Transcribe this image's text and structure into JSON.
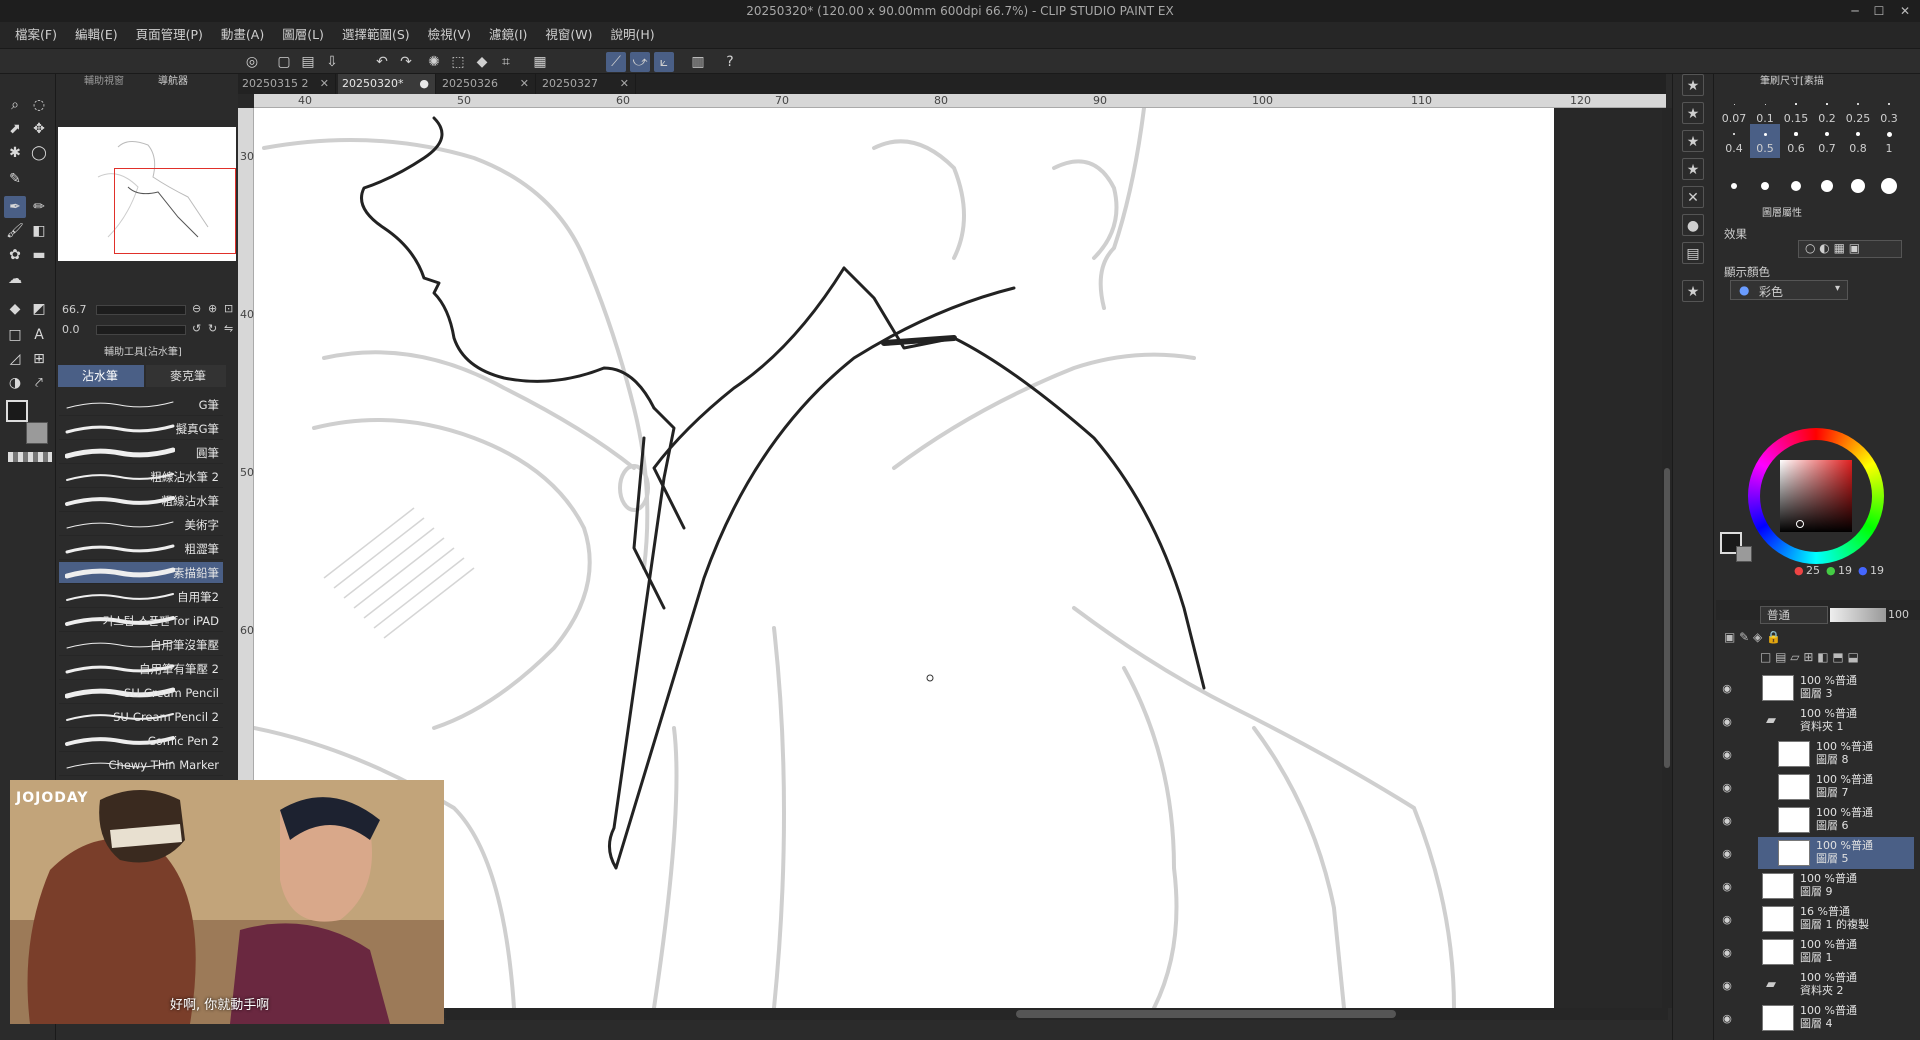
{
  "window": {
    "title": "20250320* (120.00 x 90.00mm 600dpi 66.7%) - CLIP STUDIO PAINT EX"
  },
  "menu": [
    "檔案(F)",
    "編輯(E)",
    "頁面管理(P)",
    "動畫(A)",
    "圖層(L)",
    "選擇範圍(S)",
    "檢視(V)",
    "濾鏡(I)",
    "視窗(W)",
    "說明(H)"
  ],
  "nav": {
    "tab_sub": "輔助視窗",
    "tab_nav": "導航器",
    "zoom": "66.7",
    "rotation": "0.0"
  },
  "subtool": {
    "header": "輔助工具[沾水筆]",
    "tab1": "沾水筆",
    "tab2": "麥克筆",
    "brushes": [
      "G筆",
      "擬真G筆",
      "圓筆",
      "粗線沾水筆 2",
      "粗線沾水筆",
      "美術字",
      "粗澀筆",
      "素描鉛筆",
      "自用筆2",
      "커스텀 스푼펜 for iPAD",
      "自用筆沒筆壓",
      "自用筆有筆壓 2",
      "SU-Cream Pencil",
      "SU-Cream Pencil 2",
      "Comic Pen 2",
      "Chewy Thin Marker"
    ],
    "selected_index": 7
  },
  "doc_tabs": [
    {
      "label": "20250315 2"
    },
    {
      "label": "20250320*"
    },
    {
      "label": "20250326"
    },
    {
      "label": "20250327"
    }
  ],
  "active_tab": 1,
  "ruler_h": [
    "40",
    "50",
    "60",
    "70",
    "80",
    "90",
    "100",
    "110",
    "120"
  ],
  "ruler_v": [
    "30",
    "40",
    "50",
    "60"
  ],
  "brush_size": {
    "header": "筆刷尺寸[素描",
    "sizes": [
      "0.07",
      "0.1",
      "0.15",
      "0.2",
      "0.25",
      "0.3",
      "0.4",
      "0.5",
      "0.6",
      "0.7",
      "0.8",
      "1"
    ],
    "selected": "0.5"
  },
  "layer_prop": {
    "header": "圖層屬性",
    "effect_label": "效果",
    "color_label": "顯示顏色",
    "color_value": "彩色"
  },
  "color_wheel": {
    "r": "25",
    "g": "19",
    "b": "19",
    "accent": "#c0392b"
  },
  "layer_panel": {
    "blend_mode": "普通",
    "opacity": "100",
    "layers": [
      {
        "mode": "100 %普通",
        "name": "圖層 3",
        "indent": 0
      },
      {
        "mode": "100 %普通",
        "name": "資料夾 1",
        "indent": 0,
        "folder": true
      },
      {
        "mode": "100 %普通",
        "name": "圖層 8",
        "indent": 1
      },
      {
        "mode": "100 %普通",
        "name": "圖層 7",
        "indent": 1
      },
      {
        "mode": "100 %普通",
        "name": "圖層 6",
        "indent": 1
      },
      {
        "mode": "100 %普通",
        "name": "圖層 5",
        "indent": 1,
        "selected": true
      },
      {
        "mode": "100 %普通",
        "name": "圖層 9",
        "indent": 0
      },
      {
        "mode": "16 %普通",
        "name": "圖層 1 的複製",
        "indent": 0
      },
      {
        "mode": "100 %普通",
        "name": "圖層 1",
        "indent": 0
      },
      {
        "mode": "100 %普通",
        "name": "資料夾 2",
        "indent": 0,
        "folder": true
      },
      {
        "mode": "100 %普通",
        "name": "圖層 4",
        "indent": 0
      }
    ]
  },
  "video": {
    "logo": "JOJODAY",
    "subtitle": "好啊, 你就動手啊"
  }
}
